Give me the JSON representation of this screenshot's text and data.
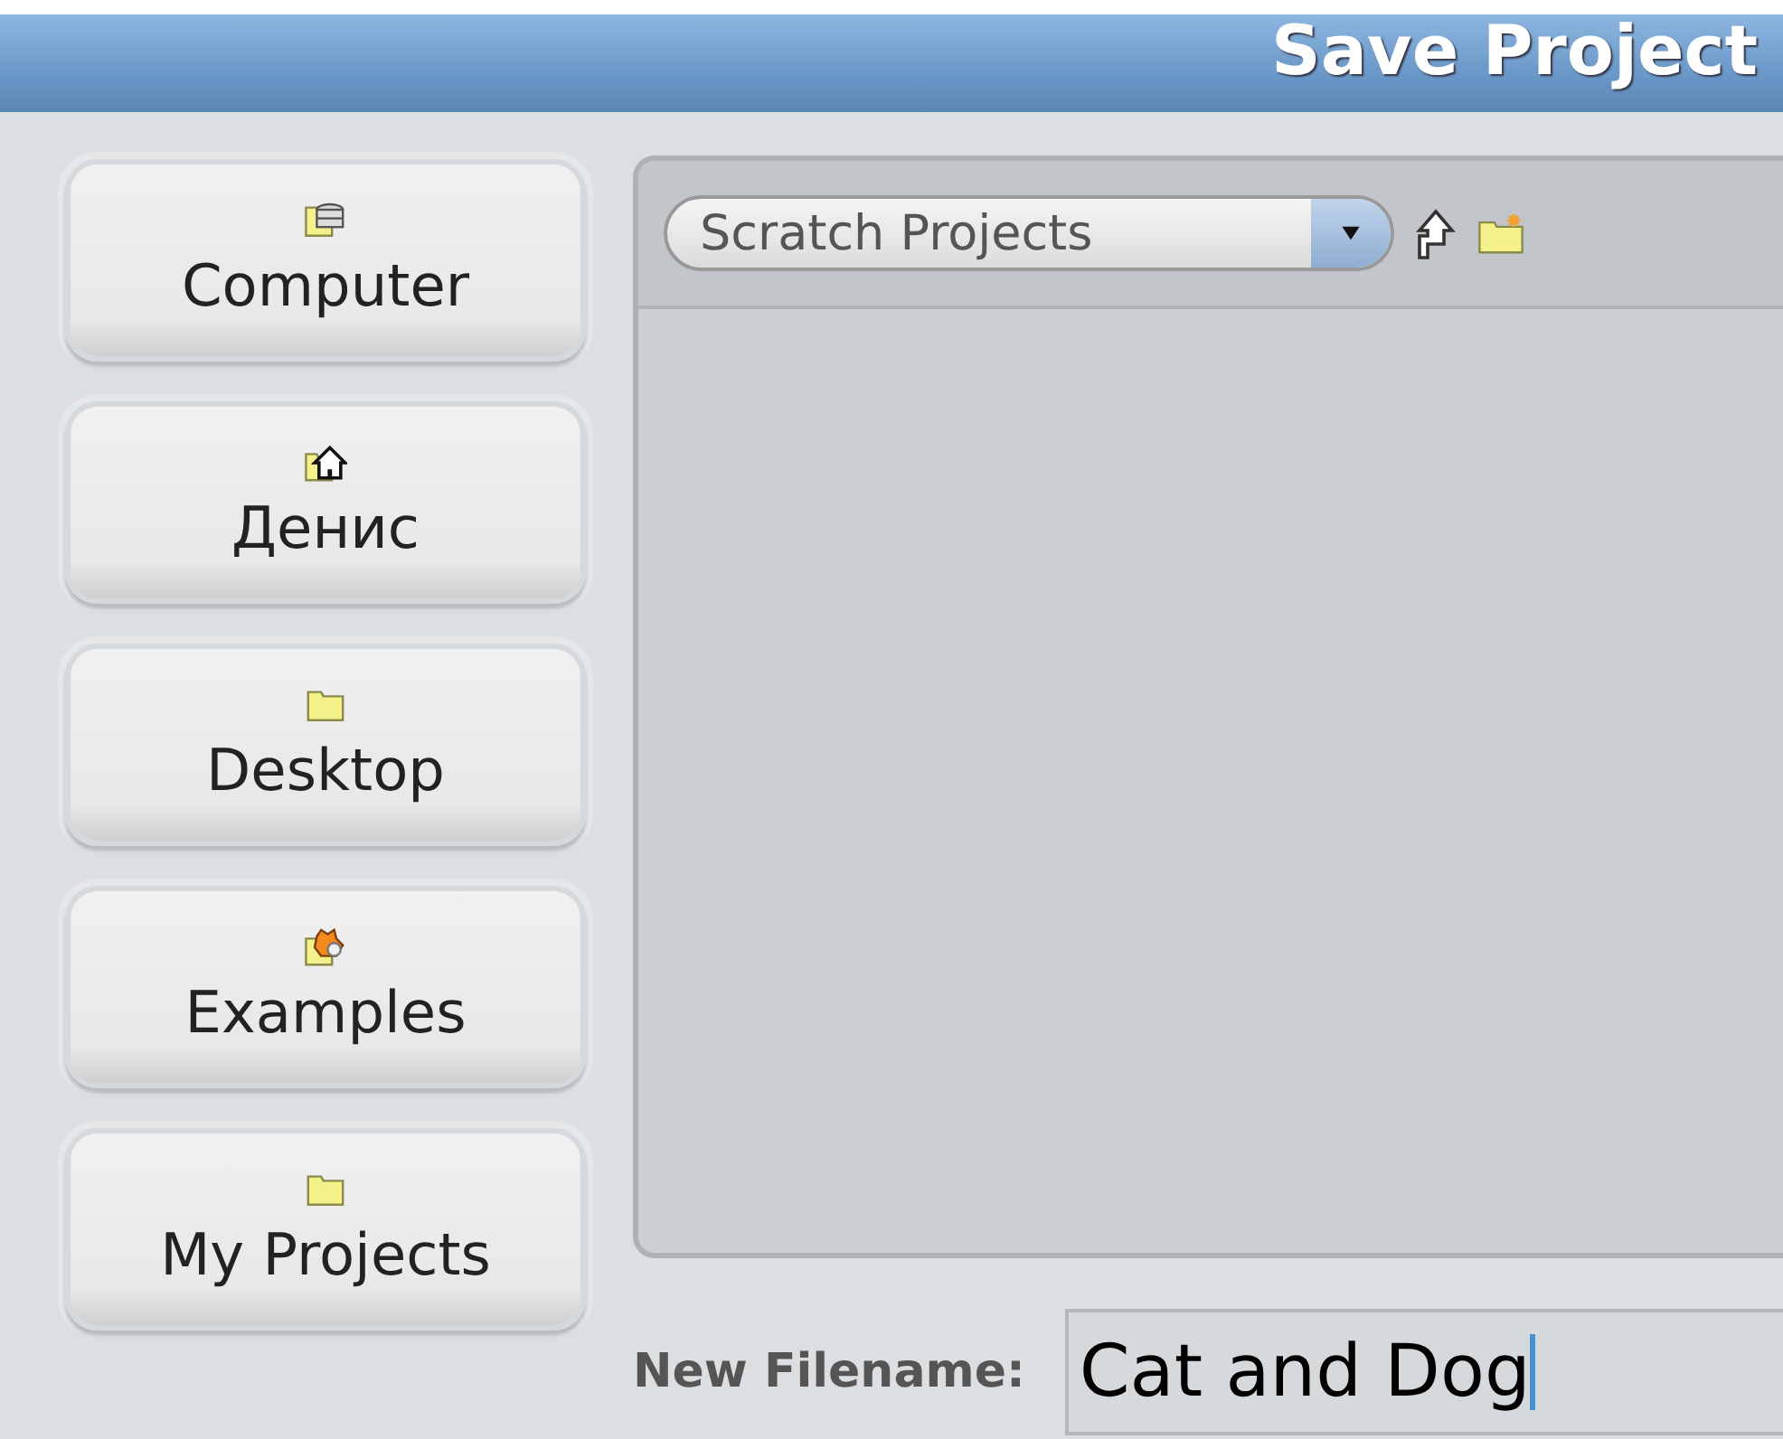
{
  "window": {
    "title": "Save Project"
  },
  "places": [
    {
      "label": "Computer",
      "kind": "computer"
    },
    {
      "label": "Денис",
      "kind": "home"
    },
    {
      "label": "Desktop",
      "kind": "folder"
    },
    {
      "label": "Examples",
      "kind": "examples"
    },
    {
      "label": "My Projects",
      "kind": "folder"
    }
  ],
  "location": {
    "value": "Scratch Projects"
  },
  "filename": {
    "label": "New Filename:",
    "value": "Cat and Dog",
    "focused": true
  }
}
